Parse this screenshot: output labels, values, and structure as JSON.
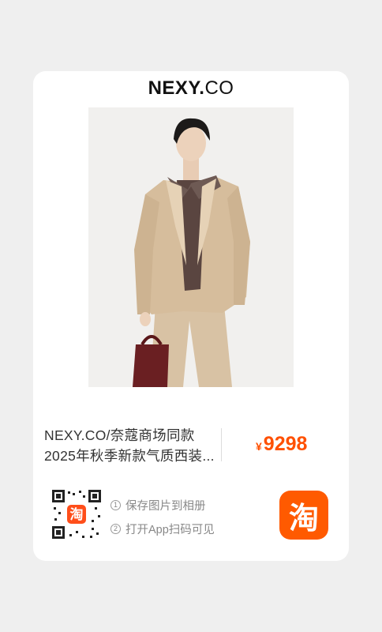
{
  "brand": {
    "name_main": "NEXY",
    "name_dot": ".",
    "name_suffix": "CO"
  },
  "product": {
    "title": "NEXY.CO/奈蔻商场同款2025年秋季新款气质西装...",
    "currency": "¥",
    "price": "9298",
    "photo_icon": "product-photo"
  },
  "share": {
    "step1_num": "1",
    "step1": "保存图片到相册",
    "step2_num": "2",
    "step2": "打开App扫码可见",
    "app_icon_glyph": "淘"
  },
  "colors": {
    "accent": "#ff5000",
    "app_icon_bg": "#ff5a00"
  }
}
